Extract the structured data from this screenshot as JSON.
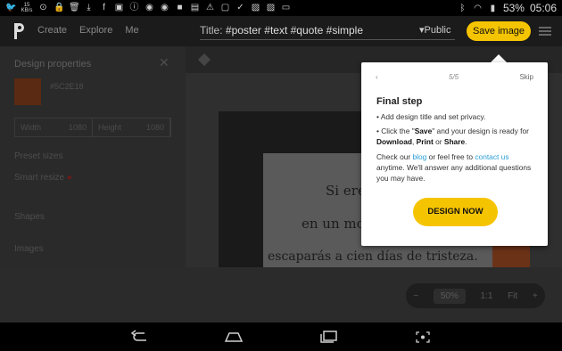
{
  "status_bar": {
    "left_icons": [
      "twitter-icon",
      "signal-speed-icon",
      "alert-icon",
      "lock-icon",
      "delete-icon",
      "download-icon",
      "facebook-icon",
      "gallery-icon",
      "info-icon",
      "chrome-icon",
      "chrome-icon",
      "video-icon",
      "photo-icon",
      "warning-icon",
      "clipboard-icon",
      "check-icon",
      "image-icon",
      "image-icon",
      "screen-icon"
    ],
    "network_speed": "15 KB/s",
    "battery": "53%",
    "time": "05:06"
  },
  "header": {
    "nav": [
      "Create",
      "Explore",
      "Me"
    ],
    "title_label": "Title:",
    "title_value": "#poster #text #quote #simple",
    "privacy": "Public",
    "save_label": "Save image"
  },
  "sidebar": {
    "heading": "Design properties",
    "hex": "#5C2E18",
    "width_label": "Width",
    "width_value": "1080",
    "height_label": "Height",
    "height_value": "1080",
    "preset_label": "Preset sizes",
    "smart_resize": "Smart resize",
    "shapes": "Shapes",
    "images": "Images"
  },
  "canvas": {
    "line1": "Si ere",
    "line2": "en un mo",
    "line3": "escaparás a cien días de tristeza."
  },
  "zoom": {
    "minus": "−",
    "percent": "50%",
    "ratio": "1:1",
    "fit": "Fit",
    "plus": "+"
  },
  "popover": {
    "prev": "‹",
    "step": "5/5",
    "skip": "Skip",
    "title": "Final step",
    "bullet1": "• Add design title and set privacy.",
    "bullet2_a": "• Click the \"",
    "bullet2_save": "Save",
    "bullet2_b": "\" and your design is ready for",
    "bullet2_download": "Download",
    "bullet2_c": ", ",
    "bullet2_print": "Print",
    "bullet2_d": " or ",
    "bullet2_share": "Share",
    "bullet2_e": ".",
    "contact_a": "Check our ",
    "contact_blog": "blog",
    "contact_b": " or feel free to ",
    "contact_us": "contact us",
    "contact_c": "anytime. We'll answer any additional questions you may have.",
    "button": "DESIGN NOW"
  },
  "colors": {
    "accent": "#f5c400",
    "link": "#2a9fd6"
  }
}
